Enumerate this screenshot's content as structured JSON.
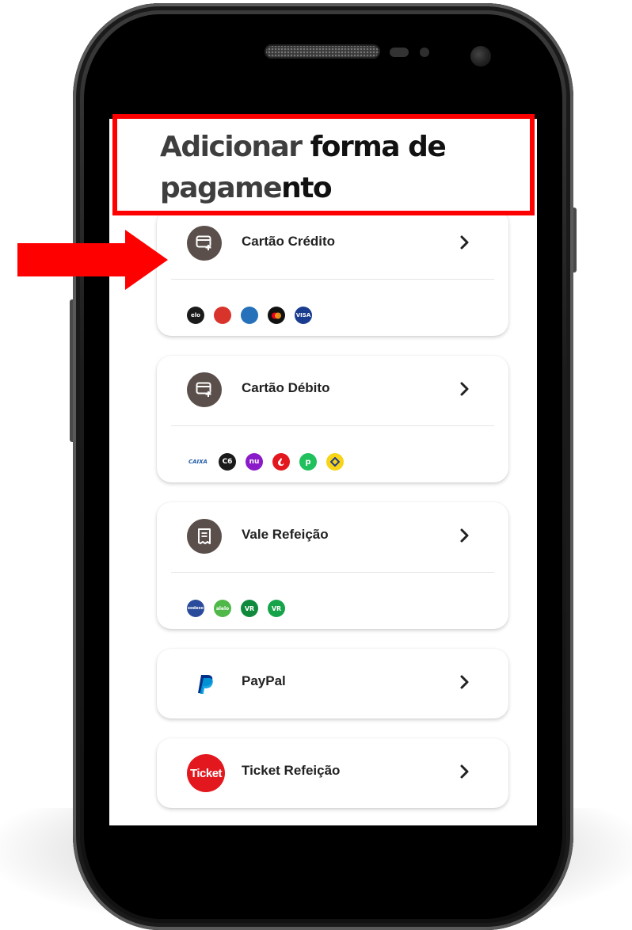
{
  "page": {
    "title_part1": "Adicionar",
    "title_part2": "forma de",
    "title_part3": "pagame",
    "title_part4": "nto"
  },
  "payment_methods": [
    {
      "label": "Cartão Crédito",
      "icon": "card-add-icon",
      "brands": [
        {
          "name": "elo-icon",
          "text": "elo",
          "color": "#1a1a1a"
        },
        {
          "name": "hipercard-icon",
          "text": "",
          "color": "#d9342b"
        },
        {
          "name": "amex-icon",
          "text": "",
          "color": "#2671b9"
        },
        {
          "name": "mastercard-icon",
          "text": "",
          "color": "#111111"
        },
        {
          "name": "visa-icon",
          "text": "VISA",
          "color": "#1a3c8f"
        }
      ]
    },
    {
      "label": "Cartão Débito",
      "icon": "card-add-icon",
      "brands": [
        {
          "name": "caixa-icon",
          "text": "CAIXA",
          "color": "#1f5aa6"
        },
        {
          "name": "c6-icon",
          "text": "C6",
          "color": "#1a1a1a"
        },
        {
          "name": "nubank-icon",
          "text": "nu",
          "color": "#8a1bc9"
        },
        {
          "name": "santander-icon",
          "text": "",
          "color": "#e3181e"
        },
        {
          "name": "picpay-icon",
          "text": "p",
          "color": "#20c05c"
        },
        {
          "name": "banco-do-brasil-icon",
          "text": "",
          "color": "#f7d417"
        }
      ]
    },
    {
      "label": "Vale Refeição",
      "icon": "receipt-icon",
      "brands": [
        {
          "name": "sodexo-icon",
          "text": "sodexo",
          "color": "#2a4b9b"
        },
        {
          "name": "alelo-icon",
          "text": "alelo",
          "color": "#4fb848"
        },
        {
          "name": "vr-icon",
          "text": "VR",
          "color": "#0f8a3c"
        },
        {
          "name": "vr-refeicao-icon",
          "text": "VR",
          "color": "#16a34a"
        }
      ]
    },
    {
      "label": "PayPal",
      "icon": "paypal-icon"
    },
    {
      "label": "Ticket Refeição",
      "icon": "ticket-icon",
      "icon_text": "Ticket"
    }
  ],
  "colors": {
    "highlight": "#ff0000",
    "icon_bg": "#5a4f4a"
  }
}
